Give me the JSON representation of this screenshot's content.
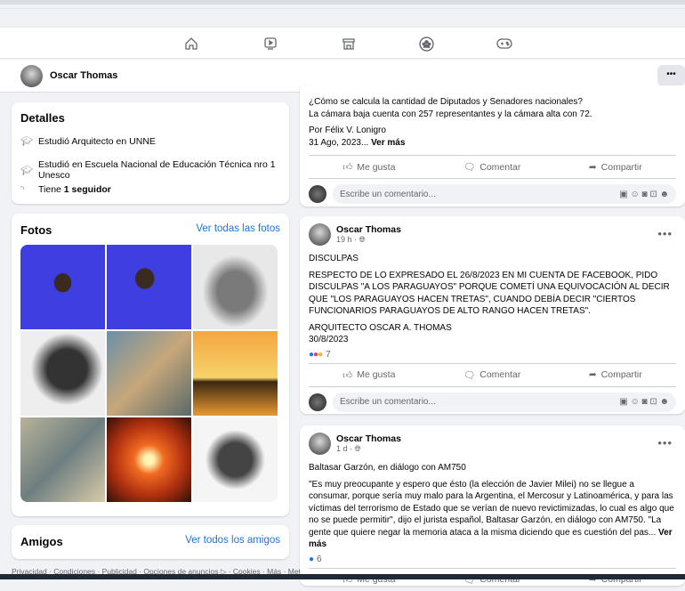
{
  "nav": {
    "icons": [
      "home-icon",
      "video-icon",
      "marketplace-icon",
      "groups-icon",
      "gaming-icon"
    ]
  },
  "profile": {
    "name": "Oscar Thomas",
    "more": "•••"
  },
  "details": {
    "title": "Detalles",
    "items": [
      {
        "icon": "graduation-cap-icon",
        "text": "Estudió Arquitecto en UNNE"
      },
      {
        "icon": "graduation-cap-icon",
        "text": "Estudió en Escuela Nacional de Educación Técnica nro 1 Unesco"
      },
      {
        "icon": "rss-icon",
        "prefix": "Tiene ",
        "bold": "1 seguidor"
      }
    ]
  },
  "photos": {
    "title": "Fotos",
    "link": "Ver todas las fotos"
  },
  "friends": {
    "title": "Amigos",
    "link": "Ver todos los amigos"
  },
  "footer": "Privacidad · Condiciones · Publicidad · Opciones de anuncios ▷ · Cookies · Más · Meta",
  "posts": [
    {
      "lines": [
        "¿Cómo se calcula la cantidad de Diputados y Senadores nacionales?",
        "La cámara baja cuenta con 257 representantes y la cámara alta con 72."
      ],
      "by": "Por Félix V. Lonigro",
      "date": "31 Ago, 2023...",
      "more": "Ver más"
    },
    {
      "author": "Oscar Thomas",
      "time": "19 h ·",
      "paragraphs": [
        "DISCULPAS",
        "RESPECTO DE LO EXPRESADO EL 26/8/2023 EN MI CUENTA DE FACEBOOK, PIDO DISCULPAS \"A LOS PARAGUAYOS\" PORQUE COMETÍ UNA EQUIVOCACIÓN AL DECIR QUE \"LOS PARAGUAYOS HACEN TRETAS\", CUANDO DEBÍA DECIR \"CIERTOS FUNCIONARIOS PARAGUAYOS DE ALTO RANGO HACEN TRETAS\".",
        "ARQUITECTO OSCAR A. THOMAS",
        "30/8/2023"
      ],
      "reactions": "7"
    },
    {
      "author": "Oscar Thomas",
      "time": "1 d ·",
      "paragraphs": [
        "Baltasar Garzón, en diálogo con AM750",
        "\"Es muy preocupante y espero que ésto (la elección de Javier Milei) no se llegue a consumar, porque sería muy malo para la Argentina, el Mercosur y Latinoamérica, y para las víctimas del terrorismo de Estado que se verían de nuevo revictimizadas, lo cual es algo que no se puede permitir\", dijo el jurista español, Baltasar Garzón, en diálogo con AM750. \"La gente que quiere negar la memoria ataca a la misma diciendo que es cuestión del pas..."
      ],
      "more": "Ver más",
      "reactions": "6"
    }
  ],
  "actions": {
    "like": "Me gusta",
    "comment": "Comentar",
    "share": "Compartir"
  },
  "comment_placeholder": "Escribe un comentario..."
}
